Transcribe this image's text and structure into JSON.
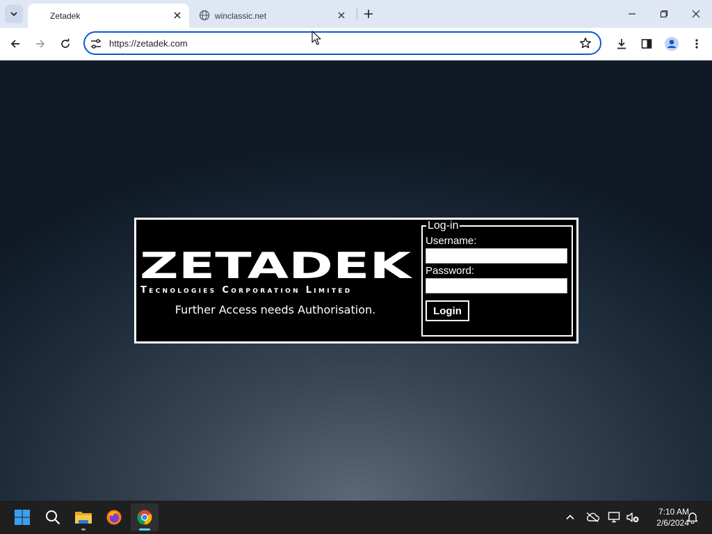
{
  "browser": {
    "tabs": [
      {
        "title": "Zetadek",
        "active": true
      },
      {
        "title": "winclassic.net",
        "active": false
      }
    ],
    "url": "https://zetadek.com"
  },
  "page": {
    "logo_text": "ZETADEK",
    "tagline": "Tecnologies Corporation Limited",
    "access_note": "Further Access needs Authorisation.",
    "login": {
      "legend": "Log-in",
      "username_label": "Username:",
      "username_value": "",
      "password_label": "Password:",
      "password_value": "",
      "button_label": "Login"
    }
  },
  "taskbar": {
    "apps": [
      "start-icon",
      "search-icon",
      "file-explorer-icon",
      "firefox-icon",
      "chrome-icon"
    ],
    "clock": {
      "time": "7:10 AM",
      "date": "2/6/2024"
    }
  },
  "colors": {
    "accent": "#0b57d0",
    "tabstrip": "#dfe6f4",
    "panel_bg": "#000000",
    "taskbar": "#1f1f1f"
  }
}
